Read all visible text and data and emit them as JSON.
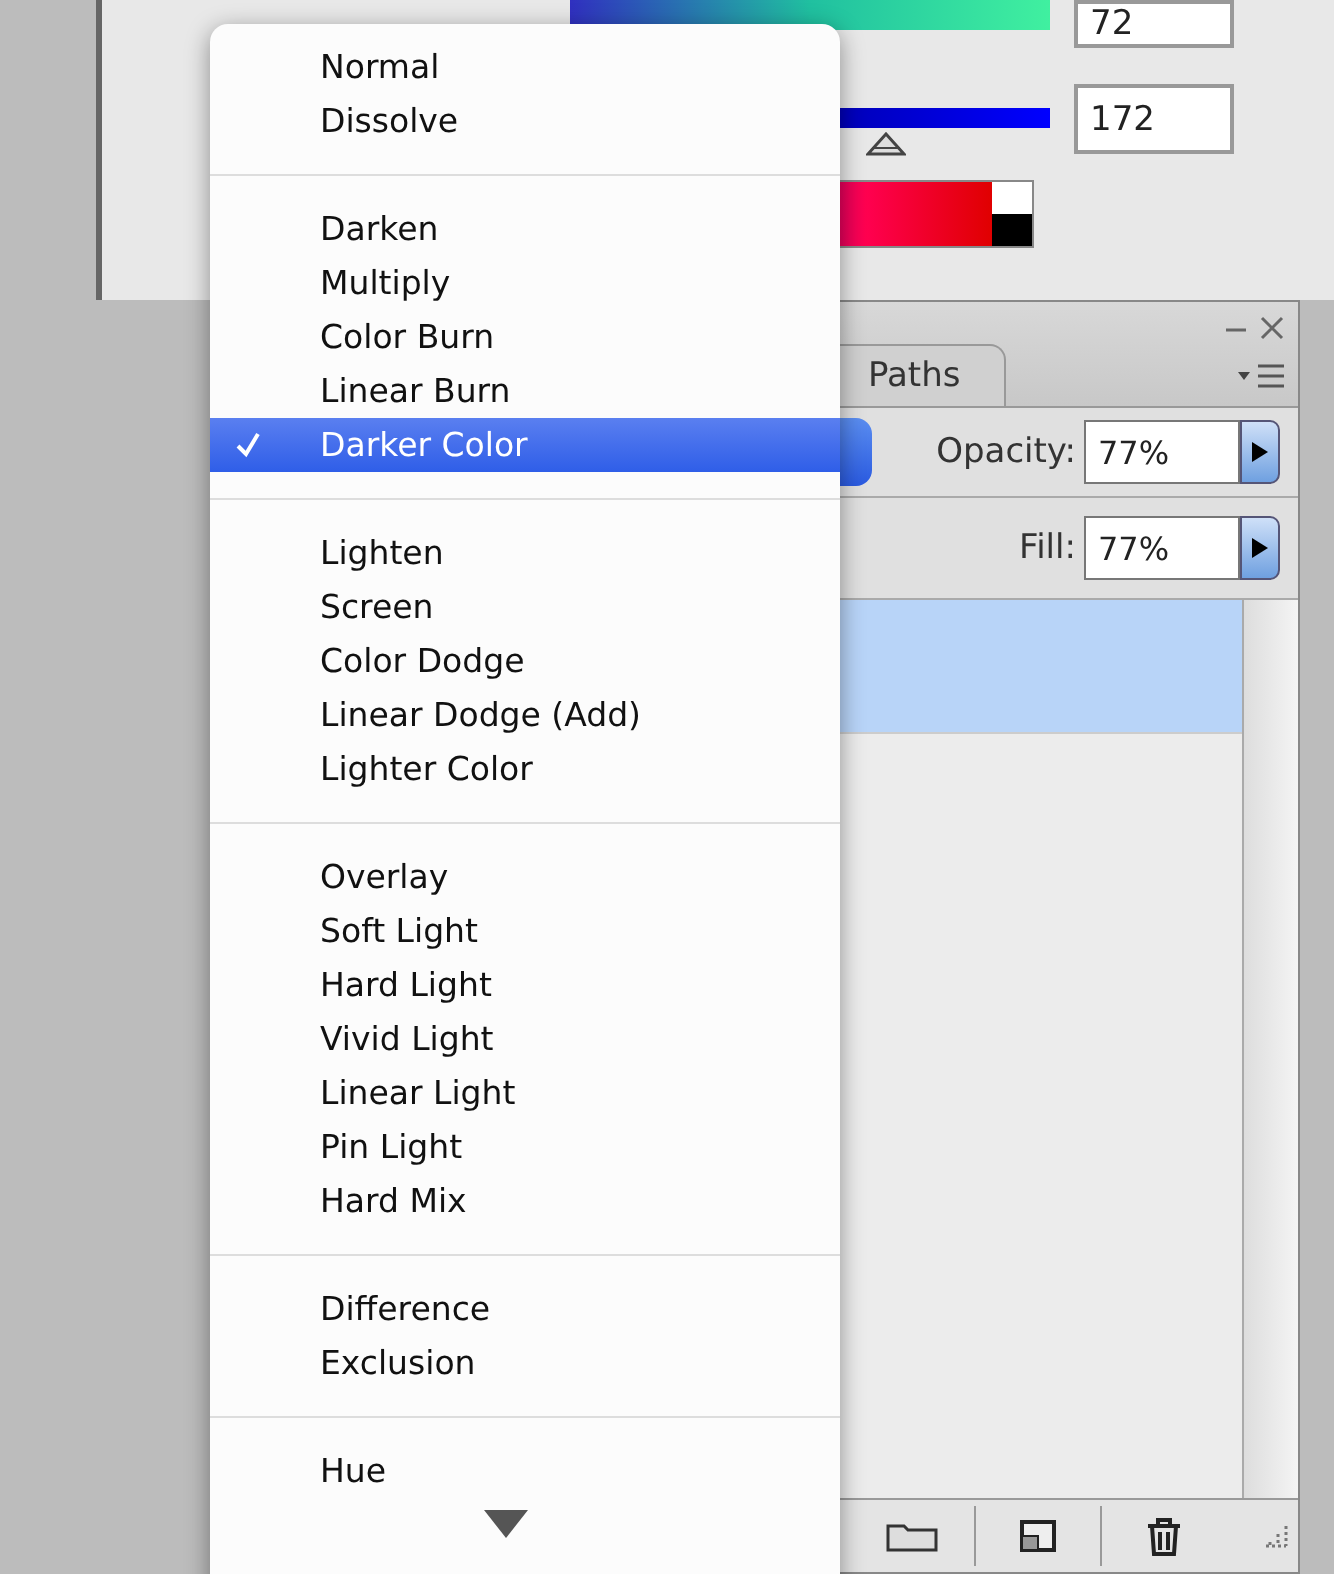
{
  "color_panel": {
    "fields": [
      {
        "value": "72"
      },
      {
        "value": "172"
      }
    ]
  },
  "layers_panel": {
    "tabs": [
      {
        "label": "Paths",
        "selected": false
      }
    ],
    "opacity": {
      "label": "Opacity:",
      "value": "77%"
    },
    "fill": {
      "label": "Fill:",
      "value": "77%"
    },
    "layers": [
      {
        "selected": true
      }
    ]
  },
  "blend_menu": {
    "groups": [
      [
        {
          "label": "Normal",
          "checked": false,
          "selected": false
        },
        {
          "label": "Dissolve",
          "checked": false,
          "selected": false
        }
      ],
      [
        {
          "label": "Darken",
          "checked": false,
          "selected": false
        },
        {
          "label": "Multiply",
          "checked": false,
          "selected": false
        },
        {
          "label": "Color Burn",
          "checked": false,
          "selected": false
        },
        {
          "label": "Linear Burn",
          "checked": false,
          "selected": false
        },
        {
          "label": "Darker Color",
          "checked": true,
          "selected": true
        }
      ],
      [
        {
          "label": "Lighten",
          "checked": false,
          "selected": false
        },
        {
          "label": "Screen",
          "checked": false,
          "selected": false
        },
        {
          "label": "Color Dodge",
          "checked": false,
          "selected": false
        },
        {
          "label": "Linear Dodge (Add)",
          "checked": false,
          "selected": false
        },
        {
          "label": "Lighter Color",
          "checked": false,
          "selected": false
        }
      ],
      [
        {
          "label": "Overlay",
          "checked": false,
          "selected": false
        },
        {
          "label": "Soft Light",
          "checked": false,
          "selected": false
        },
        {
          "label": "Hard Light",
          "checked": false,
          "selected": false
        },
        {
          "label": "Vivid Light",
          "checked": false,
          "selected": false
        },
        {
          "label": "Linear Light",
          "checked": false,
          "selected": false
        },
        {
          "label": "Pin Light",
          "checked": false,
          "selected": false
        },
        {
          "label": "Hard Mix",
          "checked": false,
          "selected": false
        }
      ],
      [
        {
          "label": "Difference",
          "checked": false,
          "selected": false
        },
        {
          "label": "Exclusion",
          "checked": false,
          "selected": false
        }
      ],
      [
        {
          "label": "Hue",
          "checked": false,
          "selected": false
        }
      ]
    ]
  }
}
